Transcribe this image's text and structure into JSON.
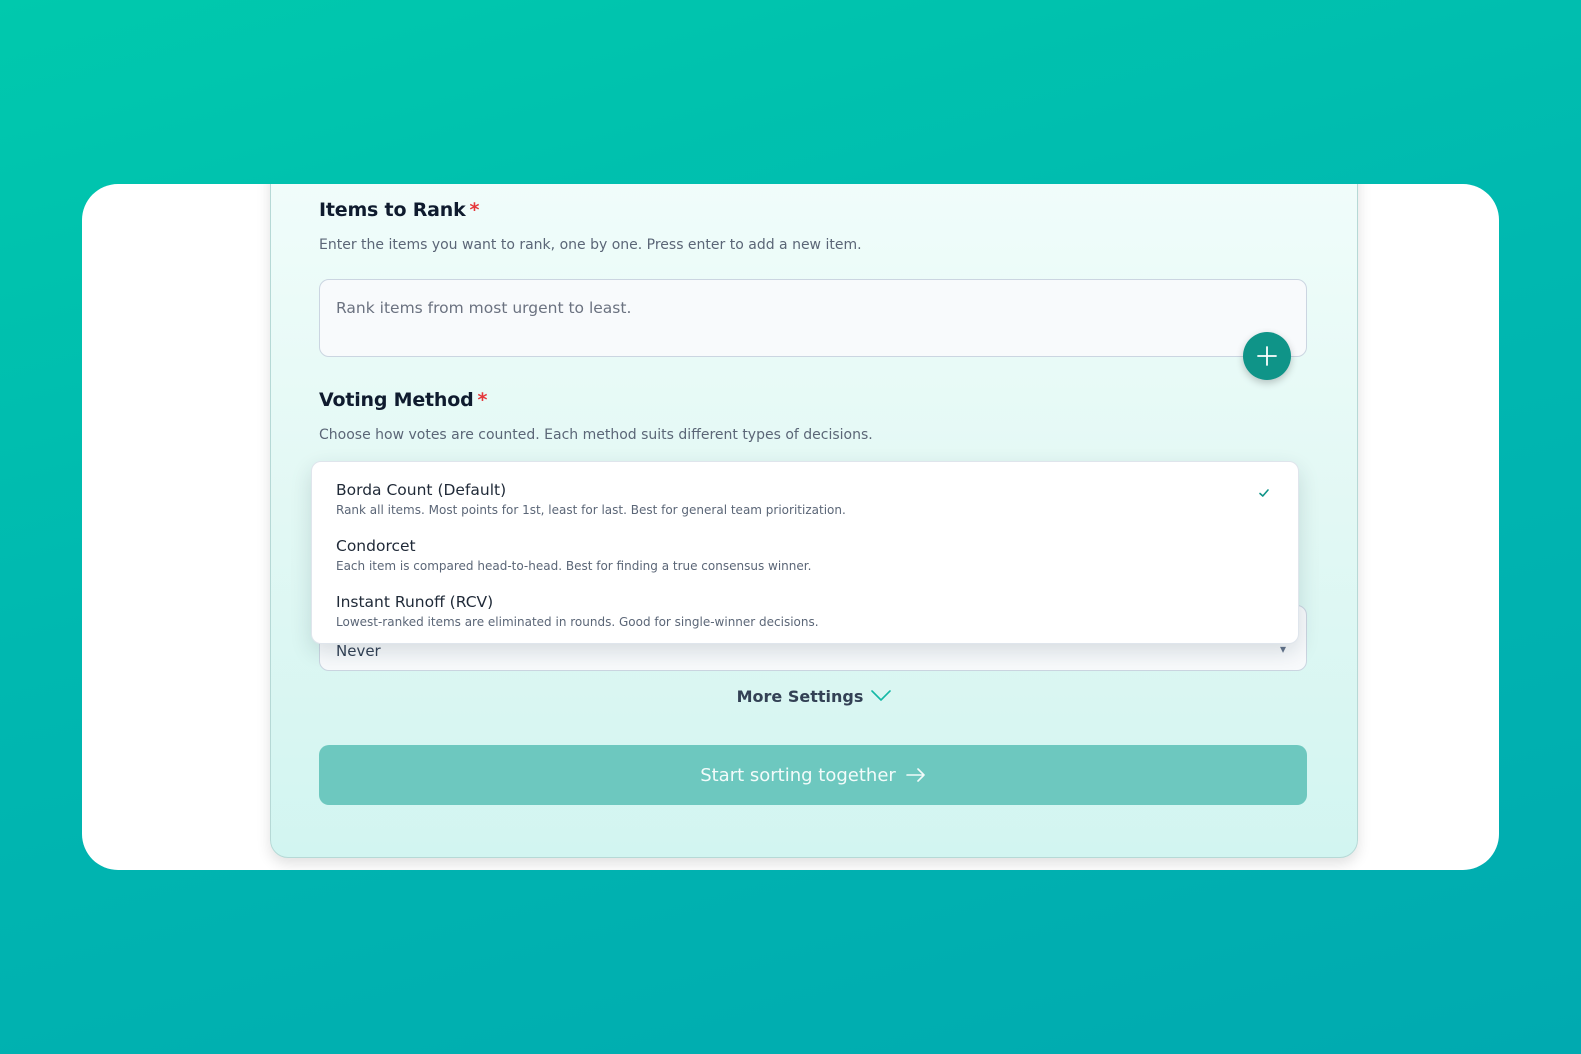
{
  "items_section": {
    "title": "Items to Rank",
    "required_mark": "*",
    "description": "Enter the items you want to rank, one by one. Press enter to add a new item.",
    "input_placeholder": "Rank items from most urgent to least."
  },
  "voting_section": {
    "title": "Voting Method",
    "required_mark": "*",
    "description": "Choose how votes are counted. Each method suits different types of decisions.",
    "options": [
      {
        "label": "Borda Count (Default)",
        "description": "Rank all items. Most points for 1st, least for last. Best for general team prioritization.",
        "selected": true
      },
      {
        "label": "Condorcet",
        "description": "Each item is compared head-to-head. Best for finding a true consensus winner."
      },
      {
        "label": "Instant Runoff (RCV)",
        "description": "Lowest-ranked items are eliminated in rounds. Good for single-winner decisions."
      }
    ]
  },
  "hidden_select": {
    "value": "Never"
  },
  "more_settings": {
    "label": "More Settings"
  },
  "start_button": {
    "label": "Start sorting together"
  },
  "colors": {
    "accent": "#0f9488",
    "button_disabled": "#6dc8bf",
    "required": "#e5383b"
  }
}
